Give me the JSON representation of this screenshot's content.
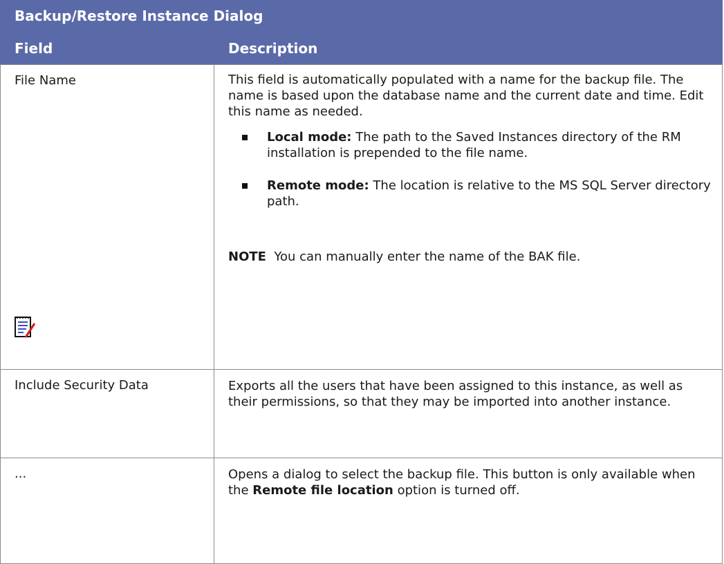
{
  "table": {
    "title": "Backup/Restore Instance Dialog",
    "headers": {
      "field": "Field",
      "description": "Description"
    },
    "rows": [
      {
        "field": "File Name",
        "description": "This field is automatically populated with a name for the backup file. The name is based upon the database name and the current date and time. Edit this name as needed.",
        "bullets": [
          {
            "label": "Local mode:",
            "text": " The path to the Saved Instances directory of the RM installation is prepended to the file name."
          },
          {
            "label": "Remote mode:",
            "text": " The location is relative to the MS SQL Server directory path."
          }
        ],
        "note": {
          "label": "NOTE",
          "text": "  You can manually enter the name of the BAK file.",
          "icon": "note-pad-icon"
        }
      },
      {
        "field": "Include Security Data",
        "description": "Exports all the users that have been assigned to this instance, as well as their permissions, so that they may be imported into another instance."
      },
      {
        "field": "...",
        "description_before": "Opens a dialog to select the backup file. This button is only available when the ",
        "description_bold": "Remote file location",
        "description_after": " option is turned off."
      }
    ]
  },
  "colors": {
    "header_bg": "#5a6aa8",
    "header_text": "#ffffff",
    "border": "#8a8a8a"
  }
}
